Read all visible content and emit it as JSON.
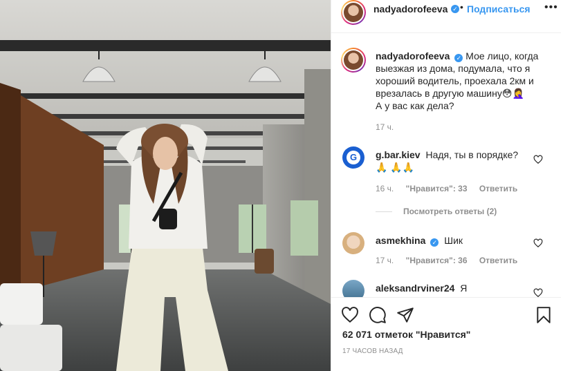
{
  "post": {
    "username": "nadyadorofeeva",
    "verified_mark": "✓",
    "separator": "•",
    "follow_label": "Подписаться",
    "more_label": "•••",
    "caption": "Мое лицо, когда выезжая из дома, подумала, что я хороший водитель, проехала 2км и врезалась в другую машину😳🤦‍♀️\nА у вас как дела?",
    "caption_time": "17 ч."
  },
  "comments": [
    {
      "username": "g.bar.kiev",
      "verified": false,
      "text": "Надя, ты в порядке? 🙏 🙏🙏",
      "time": "16 ч.",
      "likes": "\"Нравится\": 33",
      "reply_label": "Ответить",
      "view_replies": "Посмотреть ответы (2)",
      "avatar_letter": "G"
    },
    {
      "username": "asmekhina",
      "verified": true,
      "text": "Шик",
      "time": "17 ч.",
      "likes": "\"Нравится\": 36",
      "reply_label": "Ответить"
    },
    {
      "username": "aleksandrviner24",
      "verified": false,
      "text": "Я миллионер!!!"
    }
  ],
  "actions": {
    "icons": [
      "heart-icon",
      "comment-icon",
      "share-icon",
      "bookmark-icon"
    ],
    "likes_count": "62 071 отметок \"Нравится\"",
    "post_time": "17 ЧАСОВ НАЗАД"
  },
  "colors": {
    "accent": "#3897f0",
    "text": "#262626",
    "muted": "#8e8e8e",
    "border": "#efefef"
  }
}
